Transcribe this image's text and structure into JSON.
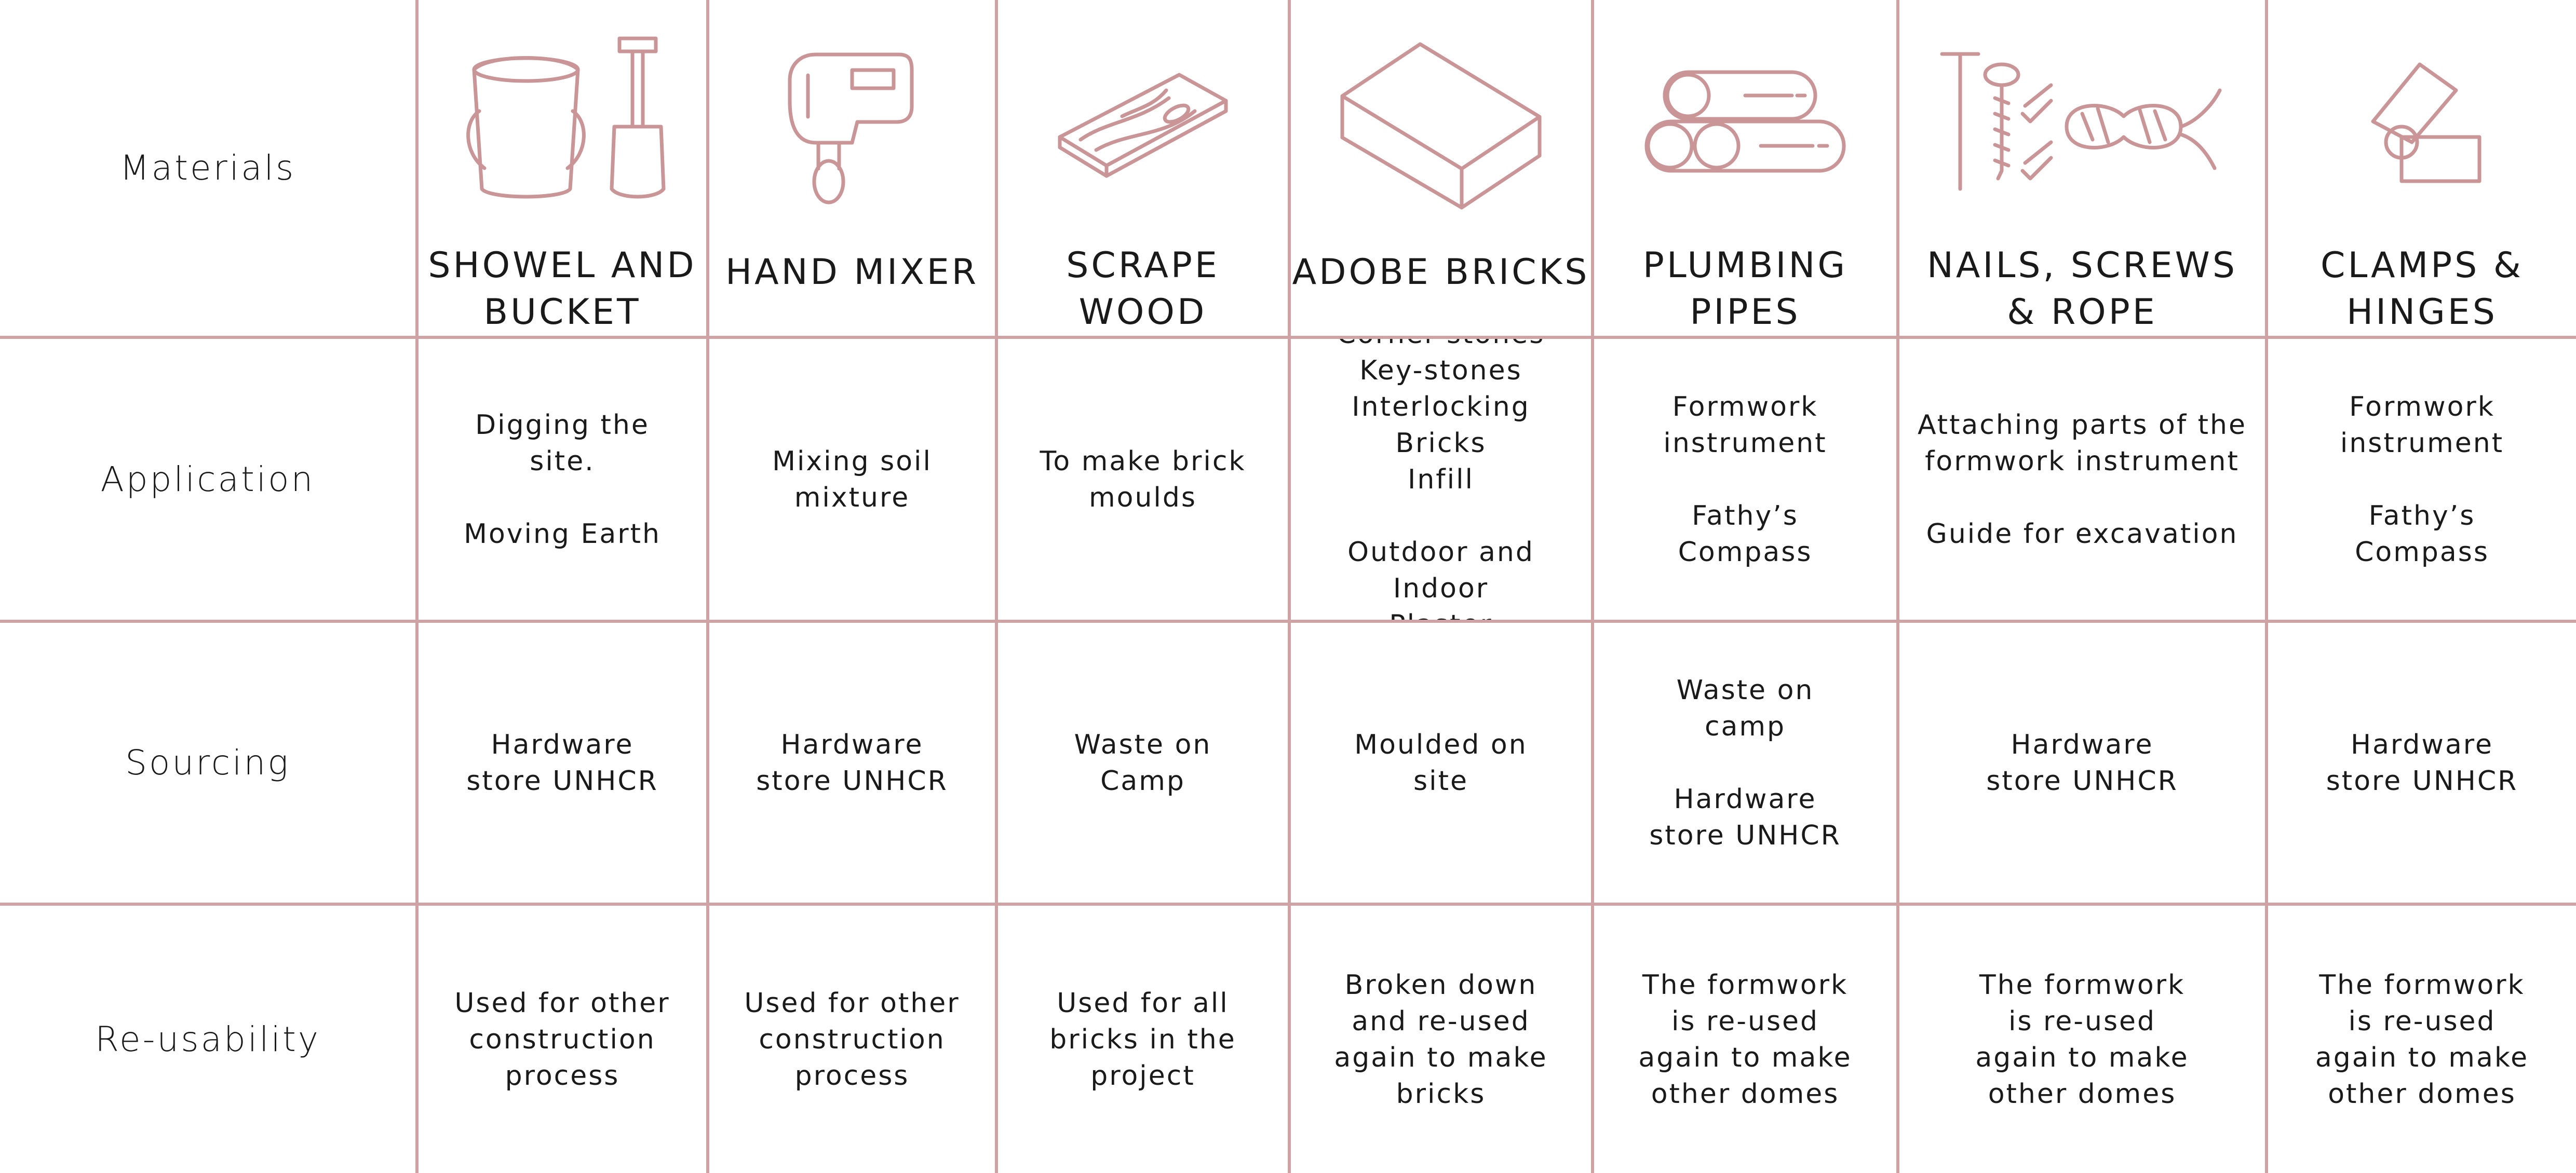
{
  "row_labels": {
    "materials": "Materials",
    "application": "Application",
    "sourcing": "Sourcing",
    "reusability": "Re-usability"
  },
  "accent_color": "#cfa3a4",
  "materials": [
    {
      "icon": "shovel-bucket-icon",
      "title": "SHOWEL AND\nBUCKET",
      "application": "Digging the\nsite.\n\nMoving Earth",
      "sourcing": "Hardware\nstore UNHCR",
      "reusability": "Used for other\nconstruction\nprocess"
    },
    {
      "icon": "hand-mixer-icon",
      "title": "HAND MIXER",
      "application": "Mixing soil\nmixture",
      "sourcing": "Hardware\nstore UNHCR",
      "reusability": "Used for other\nconstruction\nprocess"
    },
    {
      "icon": "wood-plank-icon",
      "title": "SCRAPE\nWOOD",
      "application": "To make brick\nmoulds",
      "sourcing": "Waste on\nCamp",
      "reusability": "Used for all\nbricks in the\nproject"
    },
    {
      "icon": "adobe-brick-icon",
      "title": "ADOBE BRICKS",
      "application": "Corner-stones\nKey-stones\nInterlocking Bricks\nInfill\n\nOutdoor and Indoor\nPlaster",
      "sourcing": "Moulded on\nsite",
      "reusability": "Broken down\nand re-used\nagain to make\nbricks"
    },
    {
      "icon": "pipes-icon",
      "title": "PLUMBING\nPIPES",
      "application": "Formwork\ninstrument\n\nFathy’s\nCompass",
      "sourcing": "Waste on\ncamp\n\nHardware\nstore UNHCR",
      "reusability": "The formwork\nis re-used\nagain to make\nother domes"
    },
    {
      "icon": "nails-screws-rope-icon",
      "title": "NAILS, SCREWS\n& ROPE",
      "application": "Attaching parts of the\nformwork instrument\n\nGuide for excavation",
      "sourcing": "Hardware\nstore UNHCR",
      "reusability": "The formwork\nis re-used\nagain to make\nother domes"
    },
    {
      "icon": "hinge-icon",
      "title": "CLAMPS &\nHINGES",
      "application": "Formwork\ninstrument\n\nFathy’s\nCompass",
      "sourcing": "Hardware\nstore UNHCR",
      "reusability": "The formwork\nis re-used\nagain to make\nother domes"
    }
  ]
}
